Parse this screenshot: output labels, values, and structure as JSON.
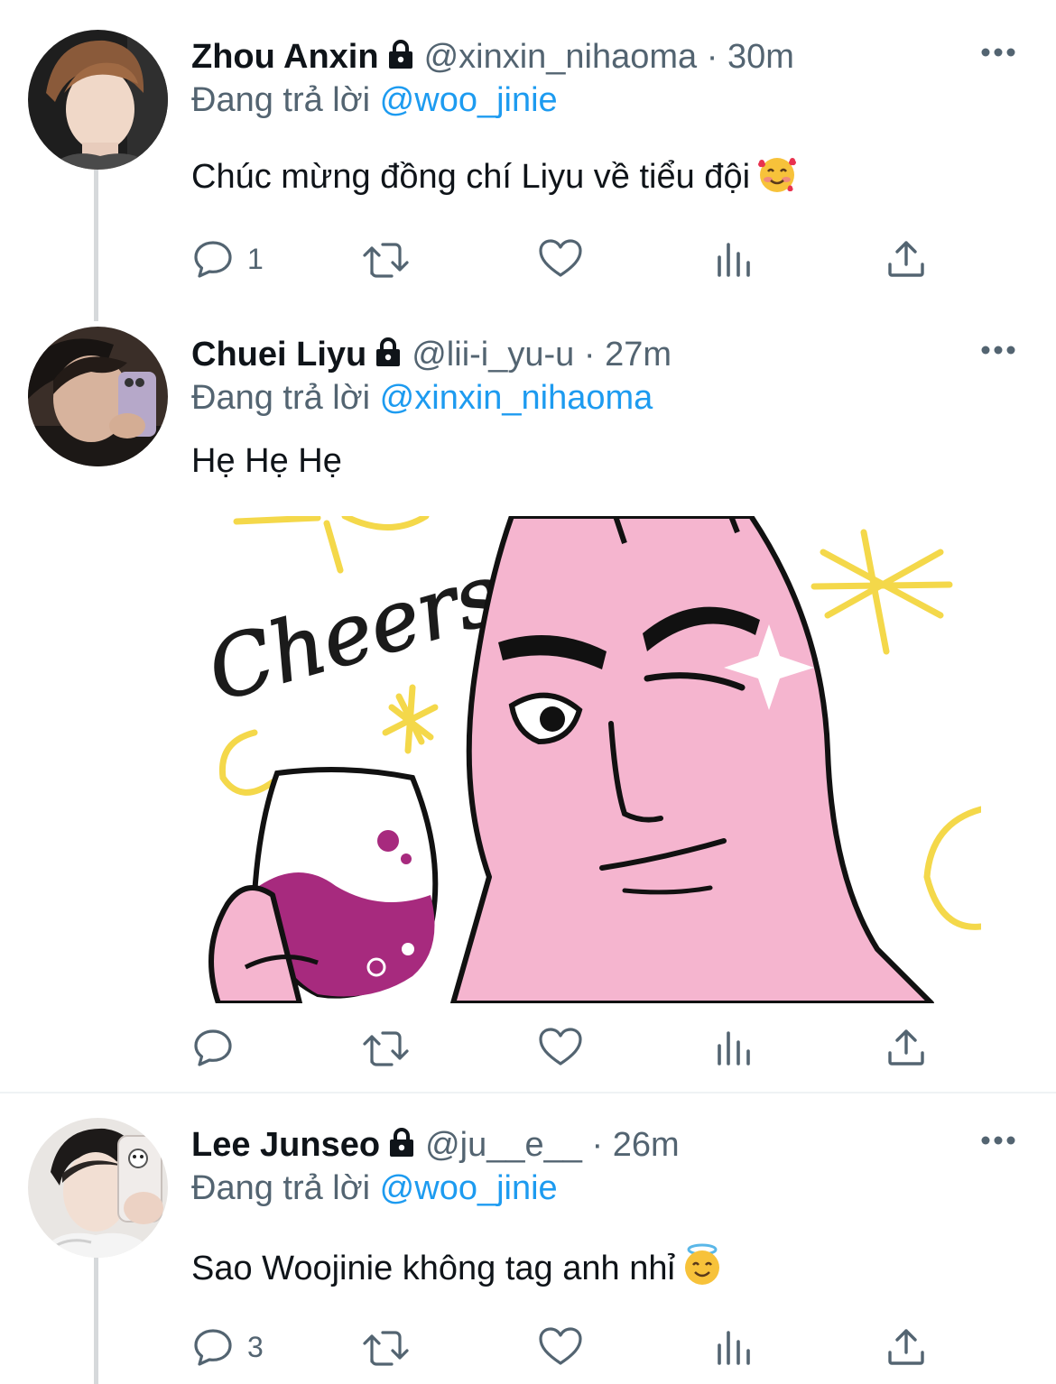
{
  "tweets": [
    {
      "name": "Zhou Anxin",
      "handle": "@xinxin_nihaoma",
      "sep": "·",
      "time": "30m",
      "reply_prefix": "Đang trả lời",
      "reply_to": "@woo_jinie",
      "text": "Chúc mừng đồng chí Liyu về tiểu đội",
      "emoji": "smiling-face-with-hearts",
      "reply_count": "1"
    },
    {
      "name": "Chuei Liyu",
      "handle": "@lii-i_yu-u",
      "sep": "·",
      "time": "27m",
      "reply_prefix": "Đang trả lời",
      "reply_to": "@xinxin_nihaoma",
      "text": "Hẹ Hẹ Hẹ",
      "media_caption": "Cheers",
      "reply_count": ""
    },
    {
      "name": "Lee Junseo",
      "handle": "@ju__e__",
      "sep": "·",
      "time": "26m",
      "reply_prefix": "Đang trả lời",
      "reply_to": "@woo_jinie",
      "text": "Sao Woojinie không tag anh nhỉ",
      "emoji": "smiling-face-with-halo",
      "reply_count": "3"
    }
  ],
  "icons": [
    "lock-icon",
    "more-icon",
    "reply-icon",
    "retweet-icon",
    "like-icon",
    "views-icon",
    "share-icon"
  ],
  "colors": {
    "text": "#0f1419",
    "secondary": "#536471",
    "link": "#1d9bf0",
    "thread_line": "#d6d9db",
    "sticker_pink": "#f5b5cf",
    "sticker_wine": "#a72a7e",
    "sticker_star": "#f4d84a"
  }
}
